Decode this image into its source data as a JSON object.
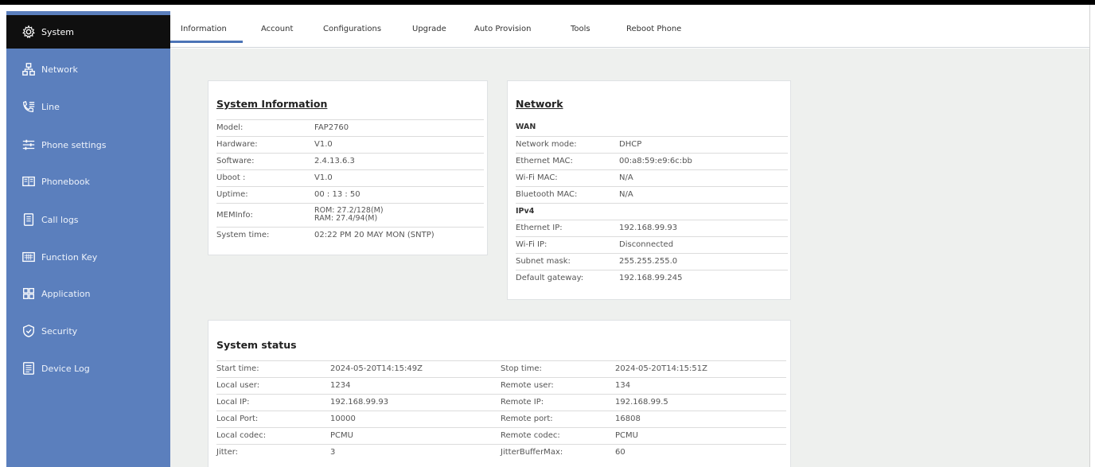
{
  "sidebar": {
    "items": [
      {
        "label": "System",
        "icon": "gear-icon"
      },
      {
        "label": "Network",
        "icon": "network-icon"
      },
      {
        "label": "Line",
        "icon": "phone-lines-icon"
      },
      {
        "label": "Phone settings",
        "icon": "sliders-icon"
      },
      {
        "label": "Phonebook",
        "icon": "book-icon"
      },
      {
        "label": "Call logs",
        "icon": "document-icon"
      },
      {
        "label": "Function Key",
        "icon": "keyboard-icon"
      },
      {
        "label": "Application",
        "icon": "grid-icon"
      },
      {
        "label": "Security",
        "icon": "shield-icon"
      },
      {
        "label": "Device Log",
        "icon": "log-icon"
      }
    ]
  },
  "tabs": [
    "Information",
    "Account",
    "Configurations",
    "Upgrade",
    "Auto Provision",
    "Tools",
    "Reboot Phone"
  ],
  "system_info": {
    "title": "System Information",
    "rows": [
      {
        "label": "Model:",
        "value": "FAP2760"
      },
      {
        "label": "Hardware:",
        "value": "V1.0"
      },
      {
        "label": "Software:",
        "value": "2.4.13.6.3"
      },
      {
        "label": "Uboot :",
        "value": "V1.0"
      },
      {
        "label": "Uptime:",
        "value": "00 : 13 : 50"
      },
      {
        "label": "MEMInfo:",
        "value": "ROM: 27.2/128(M)",
        "value2": "RAM: 27.4/94(M)"
      },
      {
        "label": "System time:",
        "value": "02:22 PM 20 MAY MON (SNTP)"
      }
    ]
  },
  "network": {
    "title": "Network",
    "wan_label": "WAN",
    "ipv4_label": "IPv4",
    "wan_rows": [
      {
        "label": "Network mode:",
        "value": "DHCP"
      },
      {
        "label": "Ethernet MAC:",
        "value": "00:a8:59:e9:6c:bb"
      },
      {
        "label": "Wi-Fi MAC:",
        "value": "N/A"
      },
      {
        "label": "Bluetooth MAC:",
        "value": "N/A"
      }
    ],
    "ipv4_rows": [
      {
        "label": "Ethernet IP:",
        "value": "192.168.99.93"
      },
      {
        "label": "Wi-Fi IP:",
        "value": "Disconnected"
      },
      {
        "label": "Subnet mask:",
        "value": "255.255.255.0"
      },
      {
        "label": "Default gateway:",
        "value": "192.168.99.245"
      }
    ]
  },
  "system_status": {
    "title": "System status",
    "rows": [
      {
        "l1": "Start time:",
        "v1": "2024-05-20T14:15:49Z",
        "l2": "Stop time:",
        "v2": "2024-05-20T14:15:51Z"
      },
      {
        "l1": "Local user:",
        "v1": "1234",
        "l2": "Remote user:",
        "v2": "134"
      },
      {
        "l1": "Local IP:",
        "v1": "192.168.99.93",
        "l2": "Remote IP:",
        "v2": "192.168.99.5"
      },
      {
        "l1": "Local Port:",
        "v1": "10000",
        "l2": "Remote port:",
        "v2": "16808"
      },
      {
        "l1": "Local codec:",
        "v1": "PCMU",
        "l2": "Remote codec:",
        "v2": "PCMU"
      },
      {
        "l1": "Jitter:",
        "v1": "3",
        "l2": "JitterBufferMax:",
        "v2": "60"
      }
    ]
  },
  "colors": {
    "sidebar": "#5b7fbd",
    "sidebar_active": "#0f0f0f",
    "accent": "#4b73b6",
    "content_bg": "#eef0ee"
  }
}
